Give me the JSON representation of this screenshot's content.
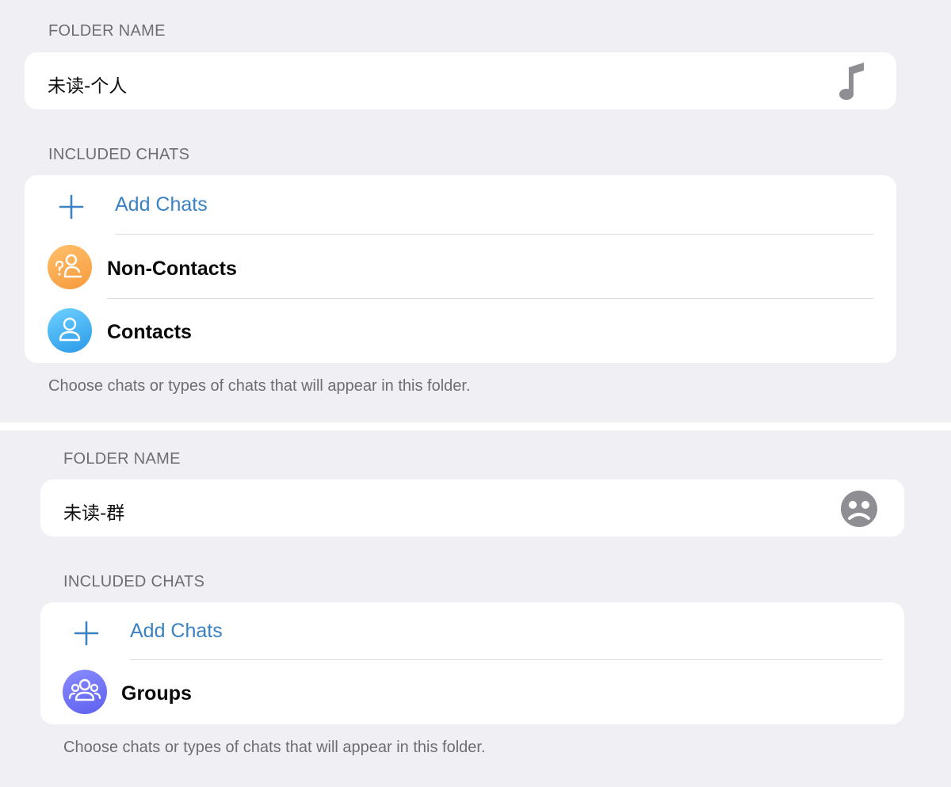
{
  "folders": [
    {
      "folder_name_header": "FOLDER NAME",
      "folder_name": "未读-个人",
      "folder_icon": "music-note-icon",
      "included_chats_header": "INCLUDED CHATS",
      "add_chats_label": "Add Chats",
      "chats": [
        {
          "label": "Non-Contacts",
          "icon": "non-contacts-icon",
          "color": "#f9a447"
        },
        {
          "label": "Contacts",
          "icon": "contacts-icon",
          "color": "#36a5ec"
        }
      ],
      "footer": "Choose chats or types of chats that will appear in this folder."
    },
    {
      "folder_name_header": "FOLDER NAME",
      "folder_name": "未读-群",
      "folder_icon": "sad-face-icon",
      "included_chats_header": "INCLUDED CHATS",
      "add_chats_label": "Add Chats",
      "chats": [
        {
          "label": "Groups",
          "icon": "groups-icon",
          "color": "#6b6ef5"
        }
      ],
      "footer": "Choose chats or types of chats that will appear in this folder."
    }
  ],
  "colors": {
    "background": "#efeff4",
    "card": "#ffffff",
    "accent": "#3b82c4",
    "secondary_text": "#6d6d72"
  }
}
